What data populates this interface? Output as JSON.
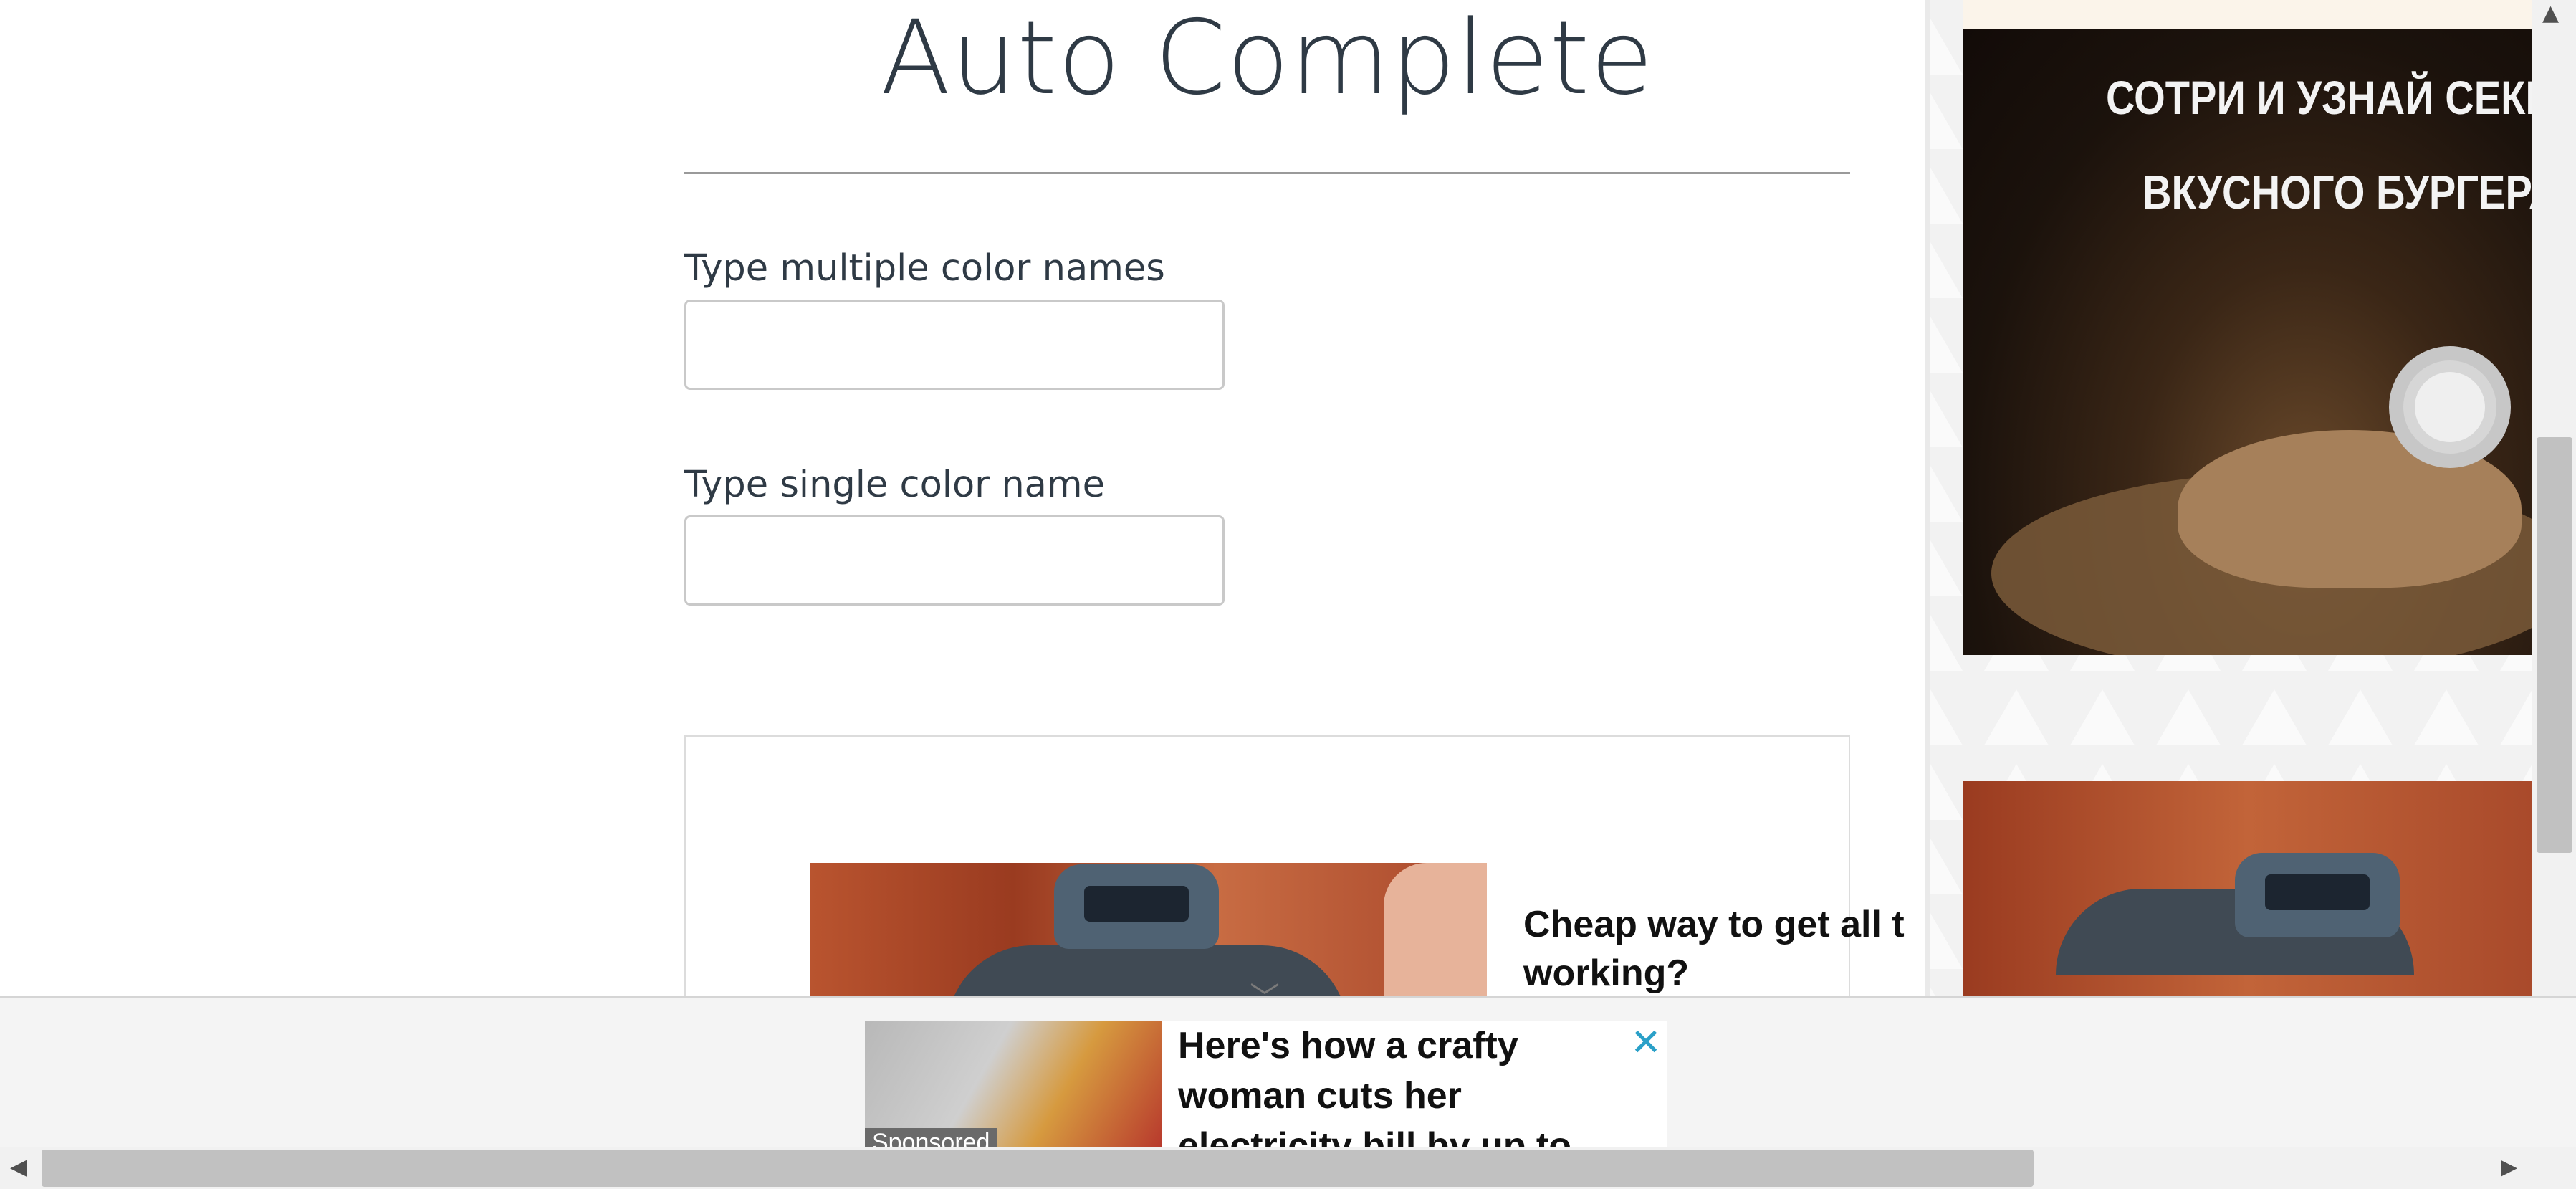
{
  "page": {
    "title": "Auto Complete"
  },
  "form": {
    "multiple_label": "Type multiple color names",
    "multiple_value": "",
    "single_label": "Type single color name",
    "single_value": ""
  },
  "inline_ad": {
    "headline_line1": "Cheap way to get all t",
    "headline_line2": "working?"
  },
  "side_ad": {
    "text_line1": "СОТРИ И УЗНАЙ СЕКРЕ",
    "text_line2": "ВКУСНОГО БУРГЕРА"
  },
  "bottom_ad": {
    "headline_line1": "Here's how a crafty",
    "headline_line2": "woman cuts her",
    "headline_line3": "electricity bill by up to",
    "sponsored_label": "Sponsored",
    "close_symbol": "✕"
  },
  "scrollbars": {
    "up_arrow": "▲",
    "down_arrow": "▼",
    "left_arrow": "◀",
    "right_arrow": "▶",
    "bottom_chevron": "﹀"
  }
}
